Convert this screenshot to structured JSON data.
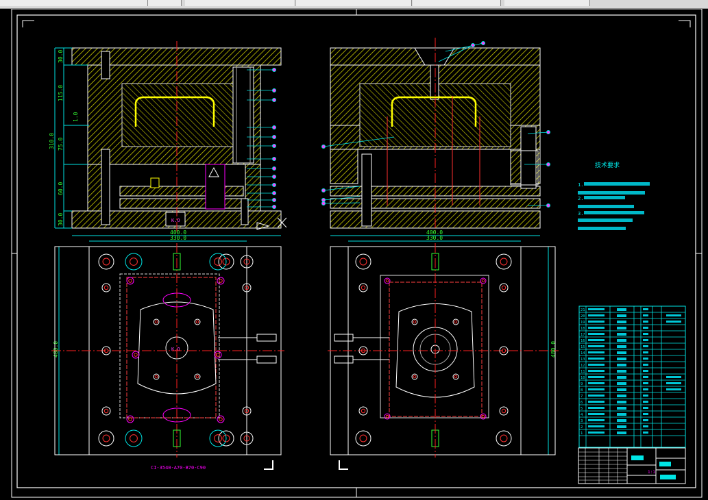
{
  "window": {
    "toolbar_segments": 6
  },
  "colors": {
    "background": "#000000",
    "frame": "#ffffff",
    "hatch": "#d8d800",
    "dimension": "#00e5e5",
    "dim_text": "#33ff33",
    "centerline": "#ff2020",
    "annotation": "#ff00ff",
    "part_outline": "#ffff00"
  },
  "section_left": {
    "dims_vertical": [
      "30.0",
      "115.0",
      "75.0",
      "60.0",
      "30.0"
    ],
    "dim_total": "310.0",
    "dim_gap": "1.0",
    "label_center": "K.O"
  },
  "plan_left": {
    "width_outer": "400.0",
    "width_inner": "330.0",
    "height": "480.0",
    "center_label": "K.O",
    "caption": "CI-3540-A70-B70-C90"
  },
  "plan_right": {
    "width_outer": "400.0",
    "width_inner": "330.0",
    "height": "480.0"
  },
  "tech_requirements": {
    "title": "技术要求",
    "items": [
      "1.",
      "2.",
      "3."
    ]
  },
  "bom": {
    "row_numbers": [
      "21",
      "20",
      "19",
      "18",
      "17",
      "16",
      "15",
      "14",
      "13",
      "12",
      "11",
      "10",
      "9",
      "8",
      "7",
      "6",
      "5",
      "4",
      "3",
      "2",
      "1"
    ]
  },
  "title_block": {
    "scale": "1:1"
  }
}
